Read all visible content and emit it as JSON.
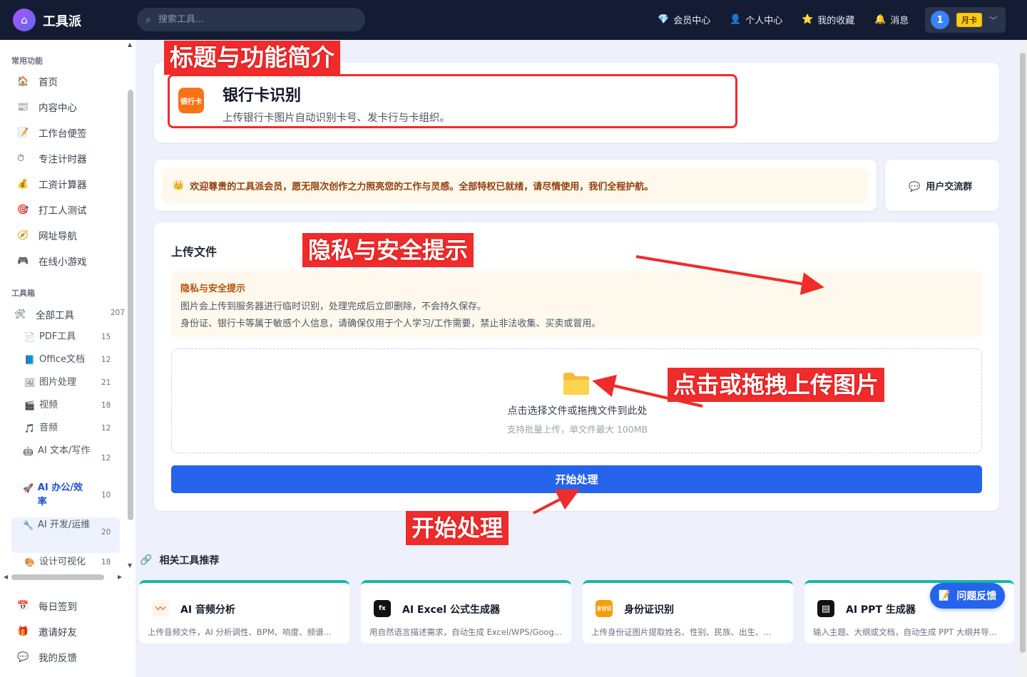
{
  "app": {
    "brand": "工具派",
    "logo_icon": "toolbox-icon"
  },
  "search": {
    "placeholder": "搜索工具..."
  },
  "nav": [
    {
      "label": "会员中心",
      "icon": "💎"
    },
    {
      "label": "个人中心",
      "icon": "👤"
    },
    {
      "label": "我的收藏",
      "icon": "⭐"
    },
    {
      "label": "消息",
      "icon": "🔔"
    }
  ],
  "user": {
    "avatar": "1",
    "vip": "月卡"
  },
  "sidebar": {
    "common_title": "常用功能",
    "common": [
      {
        "label": "首页",
        "icon": "🏠"
      },
      {
        "label": "内容中心",
        "icon": "📰"
      },
      {
        "label": "工作台便签",
        "icon": "📝"
      },
      {
        "label": "专注计时器",
        "icon": "⏱"
      },
      {
        "label": "工资计算器",
        "icon": "💰"
      },
      {
        "label": "打工人测试",
        "icon": "🎯"
      },
      {
        "label": "网址导航",
        "icon": "🧭"
      },
      {
        "label": "在线小游戏",
        "icon": "🎮"
      }
    ],
    "toolbox_title": "工具箱",
    "all_tools": {
      "label": "全部工具",
      "count": "207",
      "icon": "🛠"
    },
    "tools": [
      {
        "label": "PDF工具",
        "count": "15",
        "icon": "📄"
      },
      {
        "label": "Office文档",
        "count": "12",
        "icon": "📘"
      },
      {
        "label": "图片处理",
        "count": "21",
        "icon": "🖼"
      },
      {
        "label": "视频",
        "count": "18",
        "icon": "🎬"
      },
      {
        "label": "音频",
        "count": "12",
        "icon": "🎵"
      },
      {
        "label": "AI 文本/写作",
        "count": "12",
        "icon": "🤖"
      },
      {
        "label": "AI 办公/效率",
        "count": "10",
        "icon": "🚀"
      },
      {
        "label": "AI 开发/运维",
        "count": "20",
        "icon": "🔧"
      },
      {
        "label": "设计可视化",
        "count": "18",
        "icon": "🎨"
      }
    ],
    "bottom": [
      {
        "label": "每日签到",
        "icon": "📅"
      },
      {
        "label": "邀请好友",
        "icon": "🎁"
      },
      {
        "label": "我的反馈",
        "icon": "💬"
      }
    ]
  },
  "tool": {
    "icon_text": "银行卡",
    "title": "银行卡识别",
    "desc": "上传银行卡图片自动识别卡号、发卡行与卡组织。"
  },
  "welcome": {
    "icon": "👑",
    "text": "欢迎尊贵的工具派会员，愿无限次创作之力照亮您的工作与灵感。全部特权已就绪，请尽情使用，我们全程护航。"
  },
  "group": {
    "icon": "💬",
    "label": "用户交流群"
  },
  "upload": {
    "title": "上传文件",
    "privacy_title": "隐私与安全提示",
    "privacy_lines": [
      "图片会上传到服务器进行临时识别，处理完成后立即删除，不会持久保存。",
      "身份证、银行卡等属于敏感个人信息，请确保仅用于个人学习/工作需要，禁止非法收集、买卖或冒用。"
    ],
    "drop_main": "点击选择文件或拖拽文件到此处",
    "drop_sub": "支持批量上传，单文件最大 100MB",
    "start": "开始处理"
  },
  "related": {
    "title": "相关工具推荐",
    "icon": "🔗",
    "items": [
      {
        "name": "AI 音频分析",
        "desc": "上传音频文件，AI 分析调性、BPM、响度、频谱...",
        "icon_text": "〰",
        "color": "#fff7ed"
      },
      {
        "name": "AI Excel 公式生成器",
        "desc": "用自然语言描述需求，自动生成 Excel/WPS/Goog...",
        "icon_text": "fx",
        "color": "#111111"
      },
      {
        "name": "身份证识别",
        "desc": "上传身份证图片提取姓名、性别、民族、出生、...",
        "icon_text": "身份证",
        "color": "#f59e0b"
      },
      {
        "name": "AI PPT 生成器",
        "desc": "输入主题、大纲或文档，自动生成 PPT 大纲并导...",
        "icon_text": "▤",
        "color": "#111111"
      }
    ]
  },
  "feedback": {
    "label": "问题反馈",
    "icon": "📝"
  },
  "annotations": {
    "a1": "标题与功能简介",
    "a2": "隐私与安全提示",
    "a3": "点击或拖拽上传图片",
    "a4": "开始处理"
  }
}
